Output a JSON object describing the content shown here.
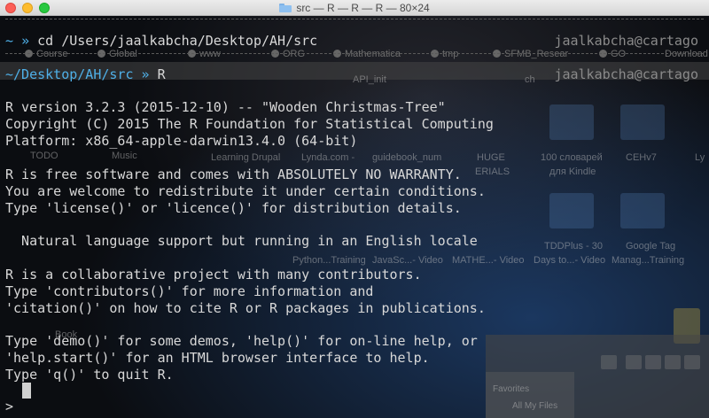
{
  "window": {
    "title": "src — R — R — R — 80×24"
  },
  "prompt1": {
    "tilde": "~",
    "arrow": "»",
    "command": "cd /Users/jaalkabcha/Desktop/AH/src",
    "host": "jaalkabcha@cartago"
  },
  "prompt2": {
    "path": "~/Desktop/AH/src",
    "arrow": "»",
    "command": "R",
    "host": "jaalkabcha@cartago"
  },
  "output": [
    "R version 3.2.3 (2015-12-10) -- \"Wooden Christmas-Tree\"",
    "Copyright (C) 2015 The R Foundation for Statistical Computing",
    "Platform: x86_64-apple-darwin13.4.0 (64-bit)",
    "",
    "R is free software and comes with ABSOLUTELY NO WARRANTY.",
    "You are welcome to redistribute it under certain conditions.",
    "Type 'license()' or 'licence()' for distribution details.",
    "",
    "  Natural language support but running in an English locale",
    "",
    "R is a collaborative project with many contributors.",
    "Type 'contributors()' for more information and",
    "'citation()' on how to cite R or R packages in publications.",
    "",
    "Type 'demo()' for some demos, 'help()' for on-line help, or",
    "'help.start()' for an HTML browser interface to help.",
    "Type 'q()' to quit R."
  ],
  "input_prompt": ">",
  "background": {
    "bookmarks": [
      "Course",
      "Global",
      "www",
      "ORG",
      "Mathematica",
      "tmp",
      "SFMB_Resear",
      "GO",
      "Download"
    ],
    "bookmarks_row2": [
      "TODO",
      "Music",
      "API_init",
      "ch"
    ],
    "desktop_labels": [
      "Learning Drupal",
      "Lynda.com -",
      "guidebook_num",
      "HUGE",
      "100 словарей",
      "CEHv7",
      "Ly"
    ],
    "desktop_labels2": [
      "ERIALS",
      "для Kindle"
    ],
    "video_labels": [
      "TDDPlus - 30",
      "Google Tag"
    ],
    "video_labels2": [
      "Python...Training",
      "JavaSc...- Video",
      "MATHE...- Video",
      "Days to...- Video",
      "Manag...Training"
    ],
    "book_label": "Book",
    "finder_favorites": "Favorites",
    "finder_all_files": "All My Files"
  },
  "colors": {
    "prompt_accent": "#4fb0e8",
    "text": "#d8d8d8",
    "host": "#8a8a8a"
  }
}
